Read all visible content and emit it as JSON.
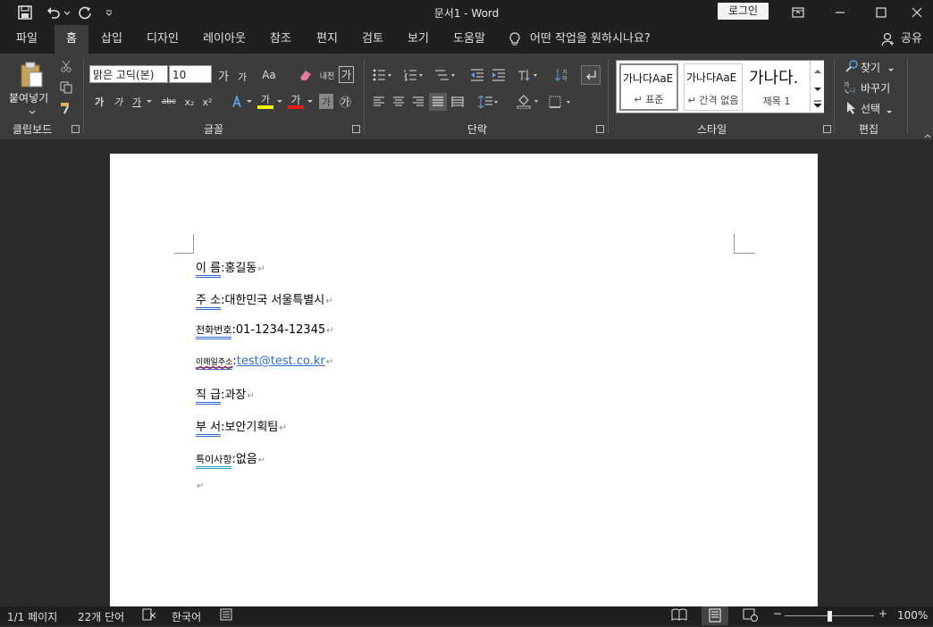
{
  "titlebar": {
    "title": "문서1  -  Word",
    "login_label": "로그인"
  },
  "tabs": [
    "파일",
    "홈",
    "삽입",
    "디자인",
    "레이아웃",
    "참조",
    "편지",
    "검토",
    "보기",
    "도움말"
  ],
  "tell_me": "어떤 작업을 원하시나요?",
  "share_label": "공유",
  "ribbon": {
    "clipboard": {
      "paste_label": "붙여넣기",
      "group_label": "클립보드"
    },
    "font": {
      "font_name": "맑은 고딕(본)",
      "font_size": "10",
      "grow": "가",
      "shrink": "가",
      "case": "Aa",
      "phonetic": "내천",
      "border_char": "가",
      "bold": "가",
      "italic": "가",
      "underline": "가",
      "strike": "abc",
      "sub": "x₂",
      "sup": "x²",
      "highlight": "가",
      "color": "가",
      "shade": "가",
      "enclose": "㉮",
      "group_label": "글꼴"
    },
    "paragraph": {
      "group_label": "단락"
    },
    "styles": {
      "items": [
        {
          "sample": "가나다AaE",
          "name": "↵ 표준"
        },
        {
          "sample": "가나다AaE",
          "name": "↵ 간격 없음"
        },
        {
          "sample": "가나다.",
          "name": "제목 1"
        }
      ],
      "group_label": "스타일"
    },
    "editing": {
      "find": "찾기",
      "replace": "바꾸기",
      "select": "선택",
      "group_label": "편집"
    }
  },
  "document": {
    "lines": [
      {
        "label": "이    름",
        "sep": " : ",
        "value": "홍길동"
      },
      {
        "label": "주    소",
        "sep": " : ",
        "value": "대한민국 서울특별시"
      },
      {
        "label": "전화번호",
        "sep": " : ",
        "value": "01-1234-12345"
      },
      {
        "label": "이메일주소",
        "sep": " : ",
        "value": "test@test.co.kr"
      },
      {
        "label": "직    급",
        "sep": " : ",
        "value": "과장"
      },
      {
        "label": "부    서",
        "sep": " : ",
        "value": "보안기획팀"
      },
      {
        "label": "특이사항",
        "sep": " : ",
        "value": "없음"
      }
    ],
    "para_mark": "↵"
  },
  "statusbar": {
    "page": "1/1 페이지",
    "words": "22개 단어",
    "language": "한국어",
    "zoom": "100%",
    "zoom_minus": "−",
    "zoom_plus": "+"
  },
  "colors": {
    "accent": "#2e6ad1",
    "titlebar": "#1f1f1f",
    "ribbon": "#3c3c3c"
  }
}
